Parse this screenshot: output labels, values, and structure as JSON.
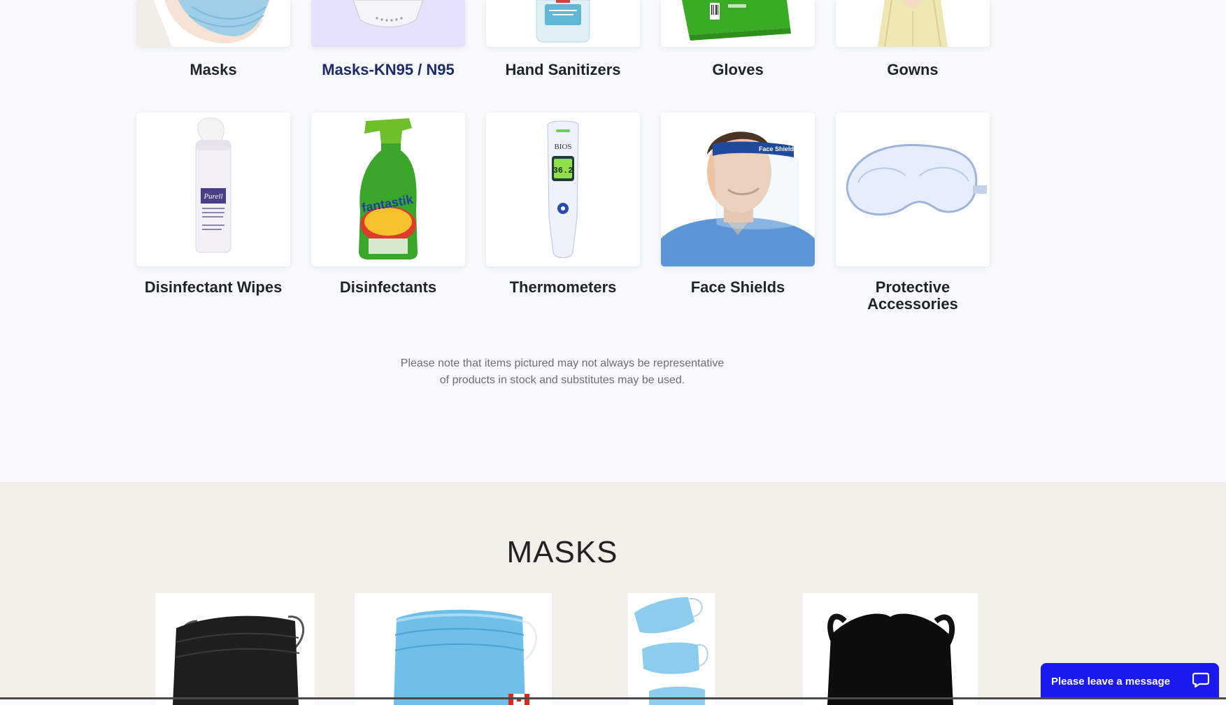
{
  "categories_row1": [
    {
      "label": "Masks",
      "image": "surgical-mask-on-face"
    },
    {
      "label": "Masks-KN95 / N95",
      "image": "kn95-mask"
    },
    {
      "label": "Hand Sanitizers",
      "image": "sanitizer-bottle"
    },
    {
      "label": "Gloves",
      "image": "gloves-box"
    },
    {
      "label": "Gowns",
      "image": "yellow-gown"
    }
  ],
  "categories_row2": [
    {
      "label": "Disinfectant Wipes",
      "image": "purell-wipes-canister"
    },
    {
      "label": "Disinfectants",
      "image": "fantastik-spray-bottle"
    },
    {
      "label": "Thermometers",
      "image": "infrared-thermometer"
    },
    {
      "label": "Face Shields",
      "image": "man-wearing-face-shield"
    },
    {
      "label": "Protective Accessories",
      "image": "safety-goggles"
    }
  ],
  "thermometer_reading": "36.2",
  "note": {
    "line1": "Please note that items pictured may not always be representative",
    "line2": "of products in stock and substitutes may be used."
  },
  "masks_section": {
    "title": "MASKS",
    "products": [
      {
        "image": "black-disposable-mask"
      },
      {
        "image": "blue-disposable-mask"
      },
      {
        "image": "blue-masks-stack"
      },
      {
        "image": "black-cloth-mask"
      }
    ]
  },
  "chat": {
    "label": "Please leave a message",
    "icon": "chat-bubble-icon"
  },
  "colors": {
    "active_category": "#1d2a6e",
    "chat_button": "#1a1aee",
    "masks_section_bg": "#f3f0ea",
    "page_bg": "#f6fafc"
  }
}
